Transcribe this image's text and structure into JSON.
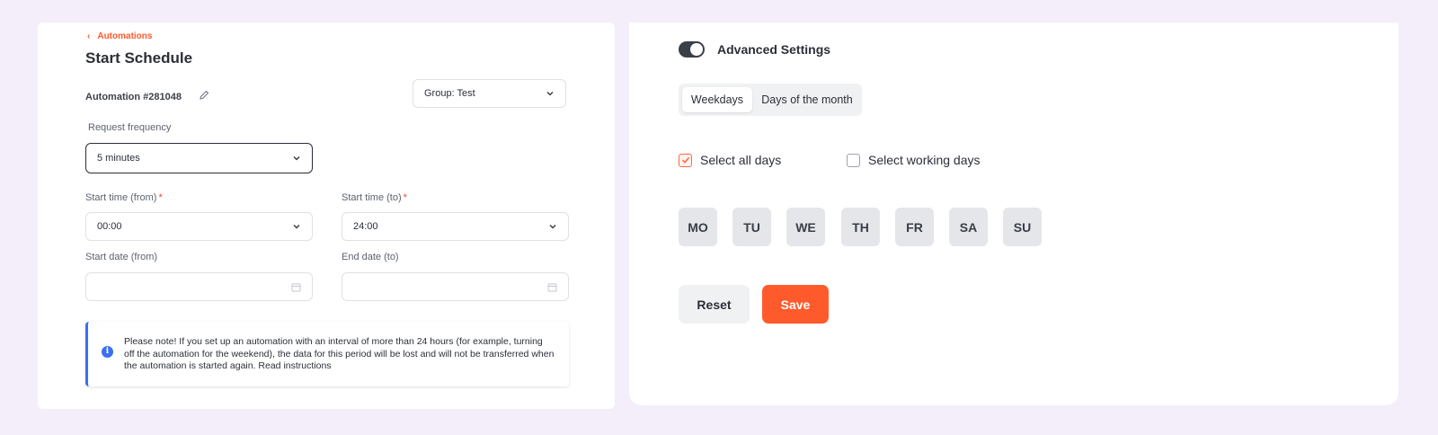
{
  "breadcrumb": {
    "label": "Automations"
  },
  "page": {
    "title": "Start Schedule"
  },
  "automation": {
    "id_label": "Automation #281048"
  },
  "group_select": {
    "value": "Group: Test"
  },
  "frequency": {
    "label": "Request frequency",
    "value": "5 minutes"
  },
  "start_time_from": {
    "label": "Start time (from)",
    "required_mark": "*",
    "value": "00:00"
  },
  "start_time_to": {
    "label": "Start time (to)",
    "required_mark": "*",
    "value": "24:00"
  },
  "start_date_from": {
    "label": "Start date (from)",
    "value": ""
  },
  "end_date_to": {
    "label": "End date (to)",
    "value": ""
  },
  "note": {
    "text": "Please note! If you set up an automation with an interval of more than 24 hours (for example, turning off the automation for the weekend), the data for this period will be lost and will not be transferred when the automation is started again. Read instructions"
  },
  "advanced": {
    "label": "Advanced Settings",
    "enabled": true
  },
  "tabs": [
    {
      "label": "Weekdays",
      "active": true
    },
    {
      "label": "Days of the month",
      "active": false
    }
  ],
  "checks": {
    "all_days": {
      "label": "Select all days",
      "checked": true
    },
    "working_days": {
      "label": "Select working days",
      "checked": false
    }
  },
  "days": [
    "MO",
    "TU",
    "WE",
    "TH",
    "FR",
    "SA",
    "SU"
  ],
  "actions": {
    "reset": "Reset",
    "save": "Save"
  },
  "colors": {
    "accent": "#ff5a2c",
    "info": "#3c6ff0",
    "background": "#f3eefa"
  }
}
